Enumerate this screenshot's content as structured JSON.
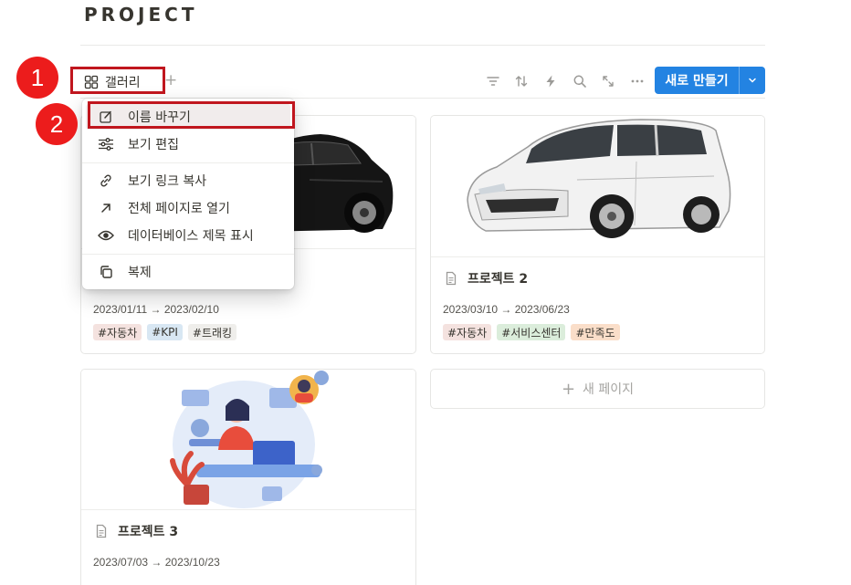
{
  "page": {
    "title": "PROJECT"
  },
  "view": {
    "tab_label": "갤러리",
    "add_view": "+"
  },
  "toolbar": {
    "icons": [
      "filter-icon",
      "sort-icon",
      "automation-icon",
      "search-icon",
      "expand-icon",
      "more-icon"
    ],
    "new_button_label": "새로 만들기"
  },
  "annotations": {
    "step1": "1",
    "step2": "2"
  },
  "menu": {
    "items": [
      {
        "label": "이름 바꾸기",
        "icon": "rename-icon"
      },
      {
        "label": "보기 편집",
        "icon": "sliders-icon"
      },
      {
        "label": "보기 링크 복사",
        "icon": "link-icon"
      },
      {
        "label": "전체 페이지로 열기",
        "icon": "arrow-up-right-icon"
      },
      {
        "label": "데이터베이스 제목 표시",
        "icon": "eye-icon"
      },
      {
        "label": "복제",
        "icon": "duplicate-icon"
      }
    ]
  },
  "cards": [
    {
      "title": "",
      "dates": "2023/01/11 → 2023/02/10",
      "tags": [
        {
          "label": "#자동차",
          "color": "#f4e2df"
        },
        {
          "label": "#KPI",
          "color": "#d8e7f3"
        },
        {
          "label": "#트래킹",
          "color": "#efeeeb"
        }
      ]
    },
    {
      "title": "프로젝트 2",
      "dates": "2023/03/10 → 2023/06/23",
      "tags": [
        {
          "label": "#자동차",
          "color": "#f4e2df"
        },
        {
          "label": "#서비스센터",
          "color": "#dbeddb"
        },
        {
          "label": "#만족도",
          "color": "#fadec9"
        }
      ]
    },
    {
      "title": "프로젝트 3",
      "dates": "2023/07/03 → 2023/10/23",
      "tags": []
    }
  ],
  "new_page_label": "새 페이지",
  "colors": {
    "accent": "#2383e2",
    "annotation": "#ec1c1c",
    "highlight_border": "#c0161e"
  }
}
